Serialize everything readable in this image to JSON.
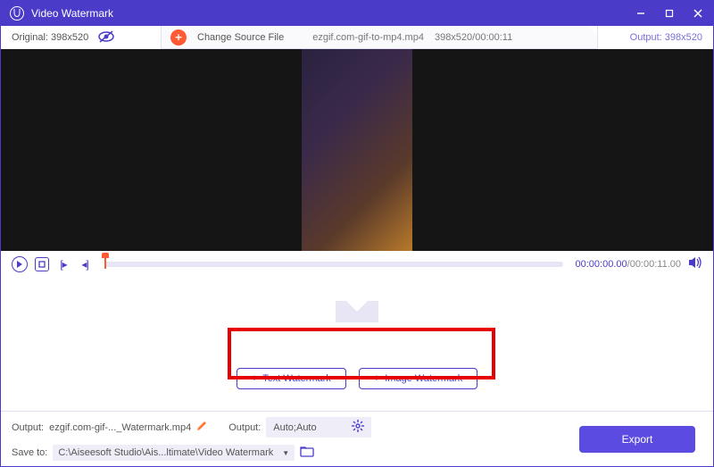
{
  "titlebar": {
    "title": "Video Watermark"
  },
  "infobar": {
    "original_label": "Original: 398x520",
    "change_source": "Change Source File",
    "filename": "ezgif.com-gif-to-mp4.mp4",
    "fileinfo": "398x520/00:00:11",
    "output_label": "Output: 398x520"
  },
  "controls": {
    "current_time": "00:00:00.00",
    "total_time": "/00:00:11.00"
  },
  "watermark": {
    "text_btn": "Text Watermark",
    "image_btn": "Image Watermark"
  },
  "footer": {
    "output_label": "Output:",
    "output_filename": "ezgif.com-gif-..._Watermark.mp4",
    "output2_label": "Output:",
    "output2_value": "Auto;Auto",
    "save_label": "Save to:",
    "save_path": "C:\\Aiseesoft Studio\\Ais...ltimate\\Video Watermark",
    "export": "Export"
  }
}
